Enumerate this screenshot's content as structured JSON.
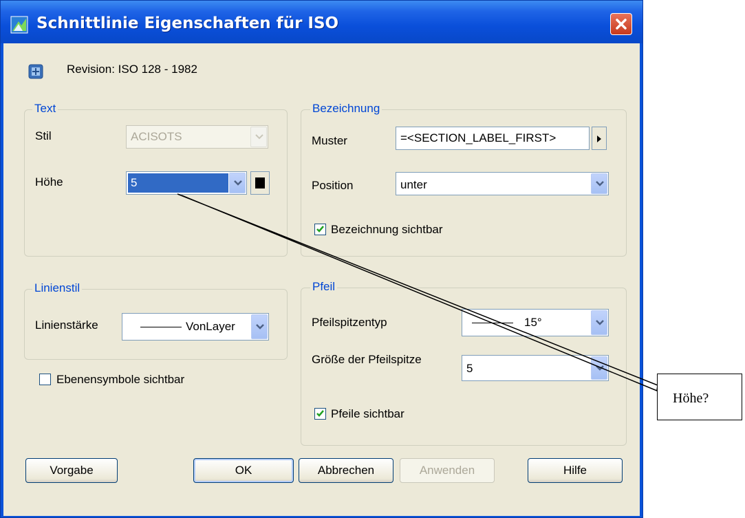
{
  "window": {
    "title": "Schnittlinie Eigenschaften für ISO"
  },
  "revision": "Revision: ISO 128 - 1982",
  "text_group": {
    "legend": "Text",
    "stil_label": "Stil",
    "stil_value": "ACISOTS",
    "hoehe_label": "Höhe",
    "hoehe_value": "5"
  },
  "bezeichnung_group": {
    "legend": "Bezeichnung",
    "muster_label": "Muster",
    "muster_value": "=<SECTION_LABEL_FIRST>",
    "position_label": "Position",
    "position_value": "unter",
    "sichtbar_label": "Bezeichnung sichtbar",
    "sichtbar_checked": true
  },
  "linienstil_group": {
    "legend": "Linienstil",
    "staerke_label": "Linienstärke",
    "staerke_value": "VonLayer"
  },
  "ebenensymbole_label": "Ebenensymbole sichtbar",
  "pfeil_group": {
    "legend": "Pfeil",
    "typ_label": "Pfeilspitzentyp",
    "typ_value": "15°",
    "groesse_label": "Größe der Pfeilspitze",
    "groesse_value": "5",
    "sichtbar_label": "Pfeile sichtbar",
    "sichtbar_checked": true
  },
  "buttons": {
    "vorgabe": "Vorgabe",
    "ok": "OK",
    "abbrechen": "Abbrechen",
    "anwenden": "Anwenden",
    "hilfe": "Hilfe"
  },
  "callout": "Höhe?",
  "colors": {
    "title_blue": "#0a52d8",
    "dialog_bg": "#ece9d8",
    "legend_blue": "#0046d5",
    "selection": "#316ac5"
  }
}
